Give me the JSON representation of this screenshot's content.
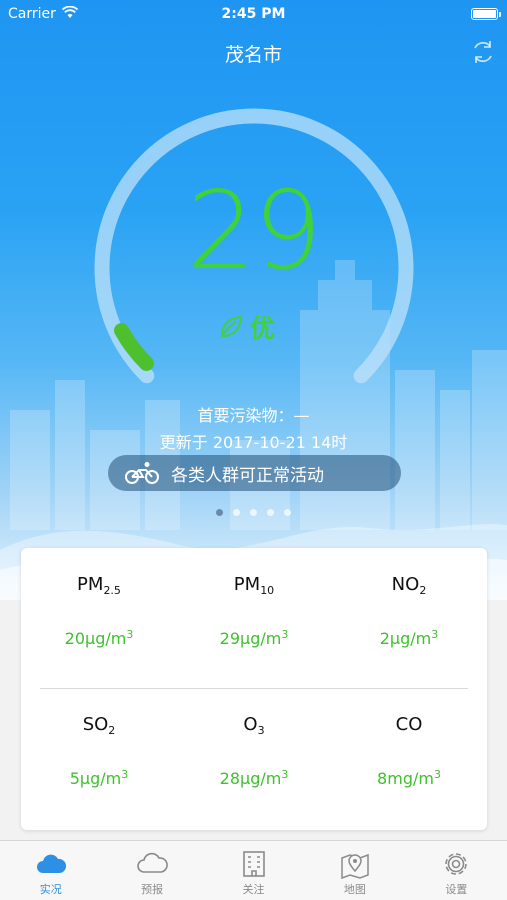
{
  "status_bar": {
    "carrier": "Carrier",
    "time": "2:45 PM"
  },
  "header": {
    "city": "茂名市",
    "refresh_icon": "refresh-icon"
  },
  "gauge": {
    "aqi": "29",
    "level": "优",
    "level_icon": "leaf-icon",
    "aqi_min": 0,
    "aqi_max": 500,
    "accent_color": "#3fd23a"
  },
  "summary": {
    "primary_pollutant": "首要污染物：—",
    "update_time": "更新于 2017-10-21 14时",
    "advice": "各类人群可正常活动",
    "advice_icon": "bicycle-icon"
  },
  "pager": {
    "count": 5,
    "active": 0
  },
  "pollutants": [
    {
      "name": "PM",
      "sub": "2.5",
      "value": "20μg/m",
      "sup": "3"
    },
    {
      "name": "PM",
      "sub": "10",
      "value": "29μg/m",
      "sup": "3"
    },
    {
      "name": "NO",
      "sub": "2",
      "value": "2μg/m",
      "sup": "3"
    },
    {
      "name": "SO",
      "sub": "2",
      "value": "5μg/m",
      "sup": "3"
    },
    {
      "name": "O",
      "sub": "3",
      "value": "28μg/m",
      "sup": "3"
    },
    {
      "name": "CO",
      "sub": "",
      "value": "8mg/m",
      "sup": "3"
    }
  ],
  "tabs": [
    {
      "label": "实况",
      "icon": "cloud-icon",
      "active": true
    },
    {
      "label": "预报",
      "icon": "forecast-cloud-icon",
      "active": false
    },
    {
      "label": "关注",
      "icon": "building-icon",
      "active": false
    },
    {
      "label": "地图",
      "icon": "map-pin-icon",
      "active": false
    },
    {
      "label": "设置",
      "icon": "gear-icon",
      "active": false
    }
  ],
  "colors": {
    "hero_top": "#1e95f2",
    "good": "#3fd23a",
    "tab_active": "#2e8fe6"
  }
}
